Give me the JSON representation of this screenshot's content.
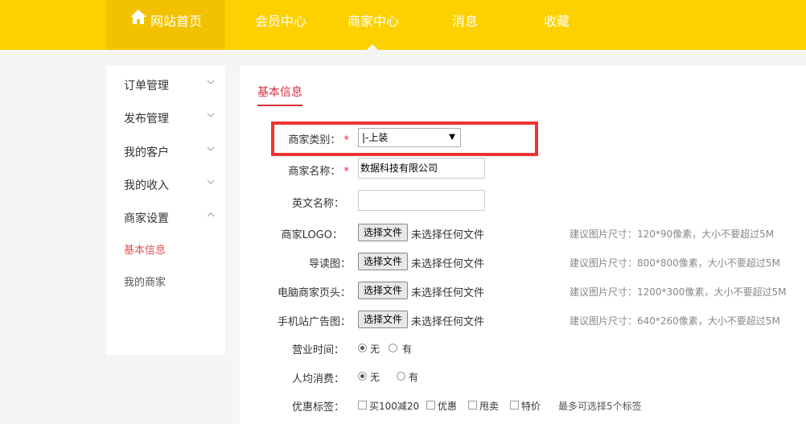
{
  "nav": {
    "home": "网站首页",
    "member": "会员中心",
    "merchant": "商家中心",
    "messages": "消息",
    "favorites": "收藏"
  },
  "sidebar": {
    "items": [
      {
        "label": "订单管理",
        "icon": "chevron-down-icon"
      },
      {
        "label": "发布管理",
        "icon": "chevron-down-icon"
      },
      {
        "label": "我的客户",
        "icon": "chevron-down-icon"
      },
      {
        "label": "我的收入",
        "icon": "chevron-down-icon"
      },
      {
        "label": "商家设置",
        "icon": "chevron-up-icon"
      }
    ],
    "sub_items": [
      {
        "label": "基本信息",
        "active": true
      },
      {
        "label": "我的商家",
        "active": false
      }
    ]
  },
  "main": {
    "tab": "基本信息",
    "form": {
      "category_label": "商家类别：",
      "category_value": "|-上装",
      "name_label": "商家名称：",
      "name_value": "数据科技有限公司",
      "english_label": "英文名称：",
      "english_value": "",
      "logo_label": "商家LOGO：",
      "guide_label": "导读图：",
      "pc_header_label": "电脑商家页头：",
      "mobile_ad_label": "手机站广告图：",
      "file_button": "选择文件",
      "file_status": "未选择任何文件",
      "logo_hint": "建议图片尺寸：120*90像素，大小不要超过5M",
      "guide_hint": "建议图片尺寸：800*800像素，大小不要超过5M",
      "pc_header_hint": "建议图片尺寸：1200*300像素，大小不要超过5M",
      "mobile_ad_hint": "建议图片尺寸：640*260像素，大小不要超过5M",
      "hours_label": "营业时间：",
      "hours_options": [
        "无",
        "有"
      ],
      "hours_selected": "无",
      "avg_label": "人均消费：",
      "avg_options": [
        "无",
        "有"
      ],
      "avg_selected": "无",
      "tags_label": "优惠标签：",
      "tags_options": [
        "买100减20",
        "优惠",
        "甩卖",
        "特价"
      ],
      "tags_hint": "最多可选择5个标签",
      "required_mark": "*"
    }
  },
  "colors": {
    "nav_bg": "#fdd100",
    "nav_home_bg": "#f2c200",
    "accent_red": "#d0303d",
    "highlight_border": "#ee3333"
  }
}
